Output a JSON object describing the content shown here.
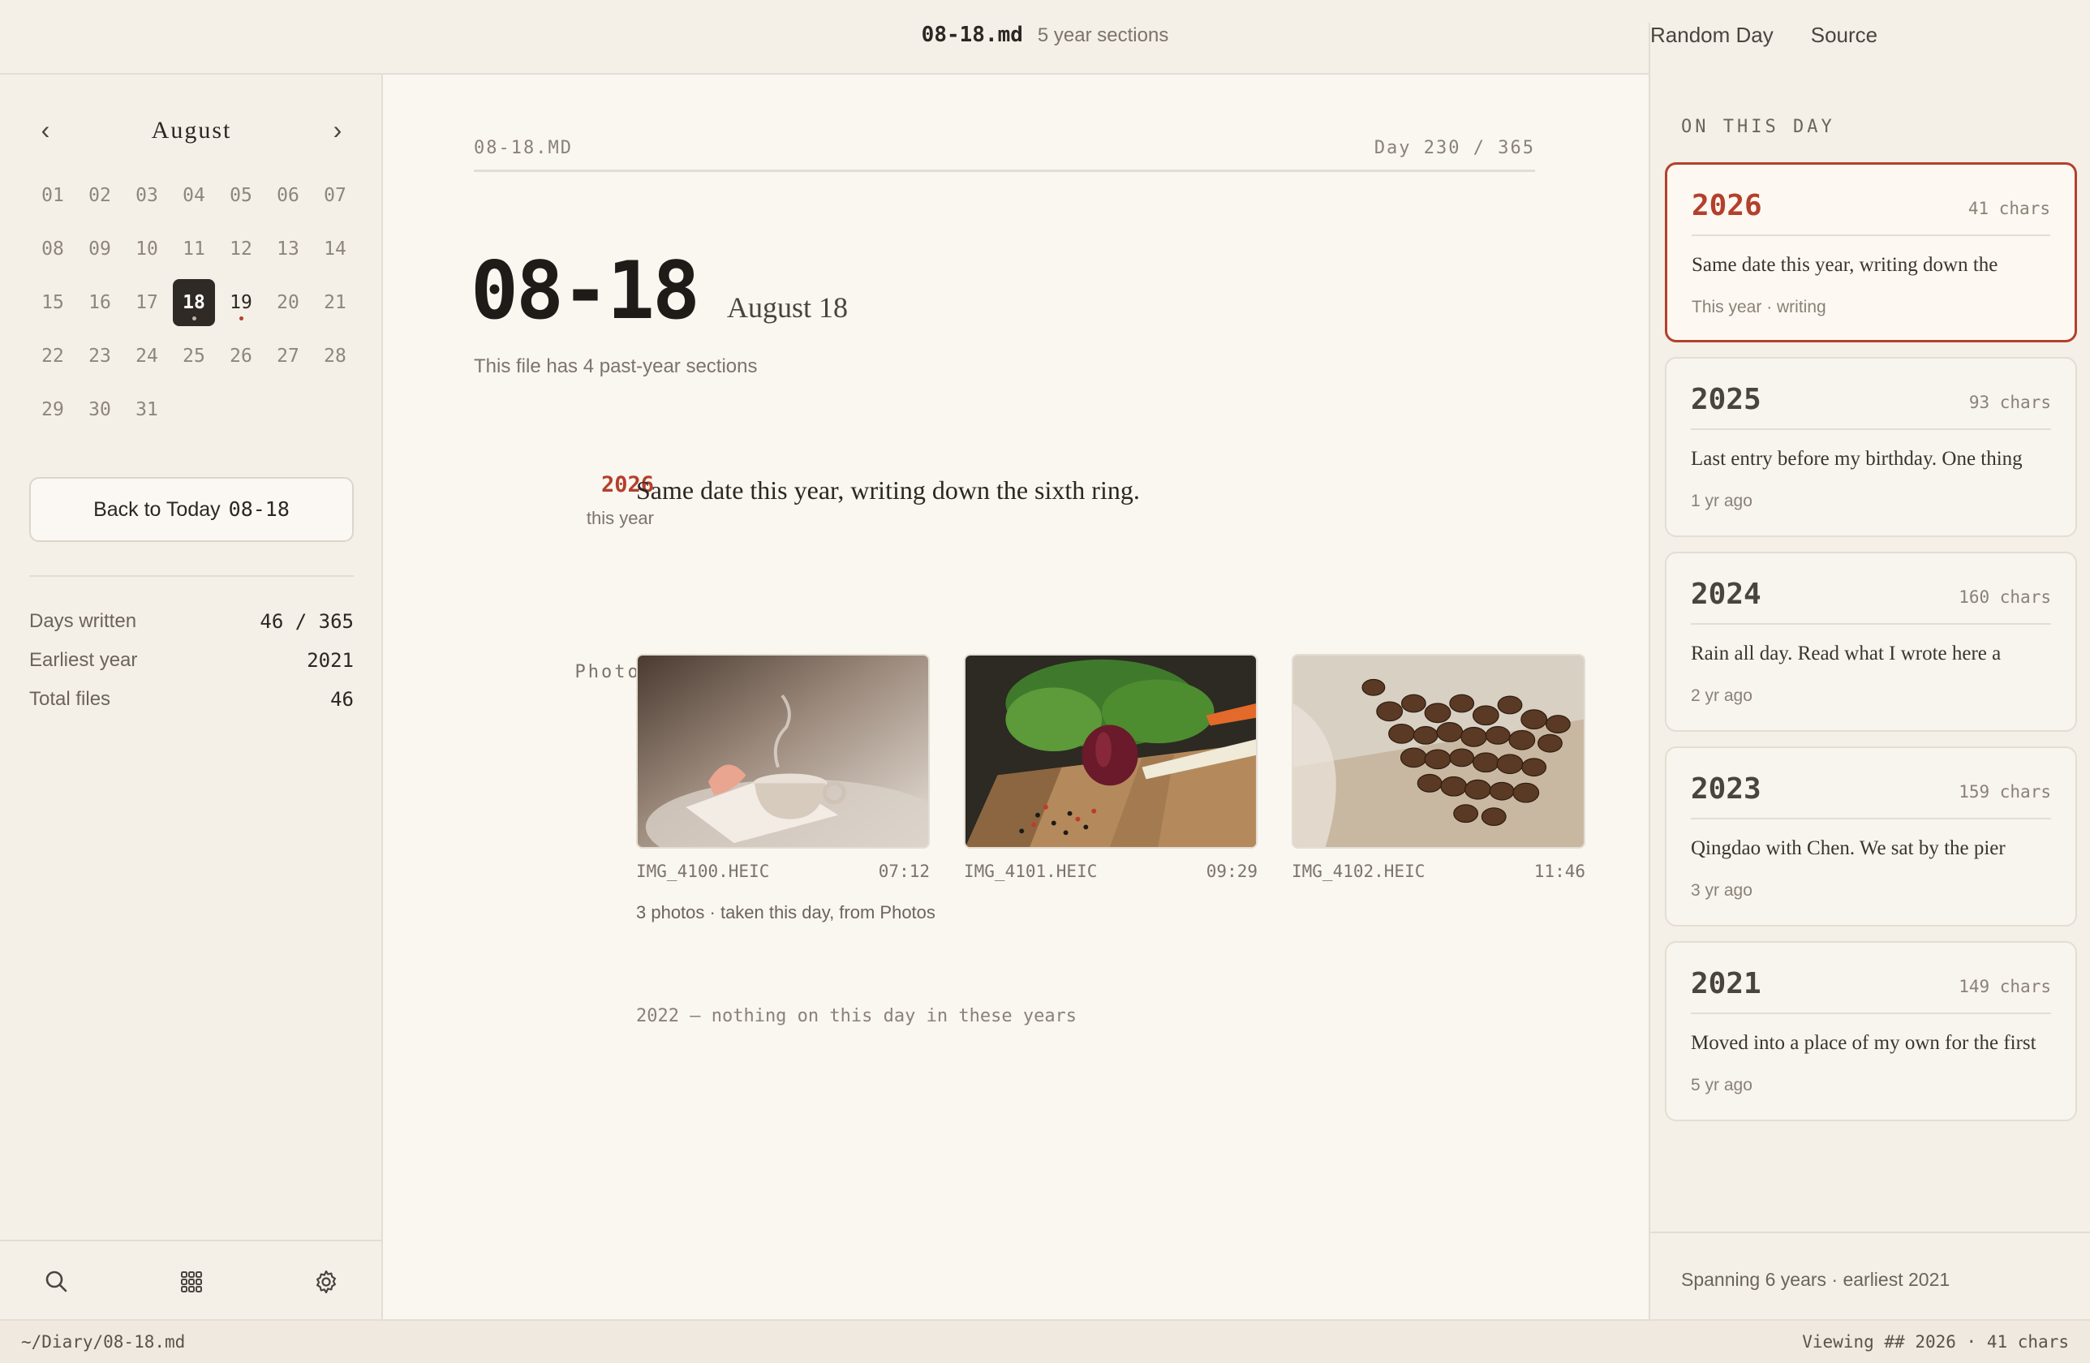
{
  "topbar": {
    "filename": "08-18.md",
    "sections": "5 year sections",
    "random_day": "Random Day",
    "source": "Source"
  },
  "calendar": {
    "prev": "‹",
    "next": "›",
    "month": "August",
    "days": [
      "01",
      "02",
      "03",
      "04",
      "05",
      "06",
      "07",
      "08",
      "09",
      "10",
      "11",
      "12",
      "13",
      "14",
      "15",
      "16",
      "17",
      "18",
      "19",
      "20",
      "21",
      "22",
      "23",
      "24",
      "25",
      "26",
      "27",
      "28",
      "29",
      "30",
      "31"
    ],
    "selected_day": "18"
  },
  "back_button": {
    "label": "Back to Today",
    "date": "08-18"
  },
  "stats": [
    {
      "label": "Days written",
      "value": "46 / 365"
    },
    {
      "label": "Earliest year",
      "value": "2021"
    },
    {
      "label": "Total files",
      "value": "46"
    }
  ],
  "tools": {
    "search": "search-icon",
    "grid": "grid-icon",
    "settings": "gear-icon"
  },
  "main": {
    "file_label": "08-18.MD",
    "day_counter": "Day 230 / 365",
    "big_date": "08-18",
    "date_sub": "August 18",
    "file_note": "This file has 4 past-year sections",
    "entry": {
      "year": "2026",
      "when": "this year",
      "text": "Same date this year, writing down the sixth ring."
    },
    "photos_label": "Photos",
    "photos": [
      {
        "name": "IMG_4100.HEIC",
        "time": "07:12",
        "subject": "tea-cup"
      },
      {
        "name": "IMG_4101.HEIC",
        "time": "09:29",
        "subject": "vegetables"
      },
      {
        "name": "IMG_4102.HEIC",
        "time": "11:46",
        "subject": "coffee-beans"
      }
    ],
    "photos_note": "3 photos · taken this day, from Photos",
    "empty_note": "2022 — nothing on this day in these years"
  },
  "on_this_day": {
    "heading": "ON THIS DAY",
    "cards": [
      {
        "year": "2026",
        "chars": "41 chars",
        "text": "Same date this year, writing down the",
        "meta": "This year · writing",
        "active": true
      },
      {
        "year": "2025",
        "chars": "93 chars",
        "text": "Last entry before my birthday. One thing",
        "meta": "1 yr ago",
        "active": false
      },
      {
        "year": "2024",
        "chars": "160 chars",
        "text": "Rain all day. Read what I wrote here a",
        "meta": "2 yr ago",
        "active": false
      },
      {
        "year": "2023",
        "chars": "159 chars",
        "text": "Qingdao with Chen. We sat by the pier",
        "meta": "3 yr ago",
        "active": false
      },
      {
        "year": "2021",
        "chars": "149 chars",
        "text": "Moved into a place of my own for the first",
        "meta": "5 yr ago",
        "active": false
      }
    ],
    "footer": "Spanning 6 years · earliest 2021"
  },
  "statusbar": {
    "path": "~/Diary/08-18.md",
    "viewing": "Viewing ## 2026 · 41 chars"
  },
  "colors": {
    "accent": "#b3402c",
    "background": "#f4efe7",
    "main_bg": "#faf6f0",
    "selected_day_bg": "#2f2a26"
  }
}
